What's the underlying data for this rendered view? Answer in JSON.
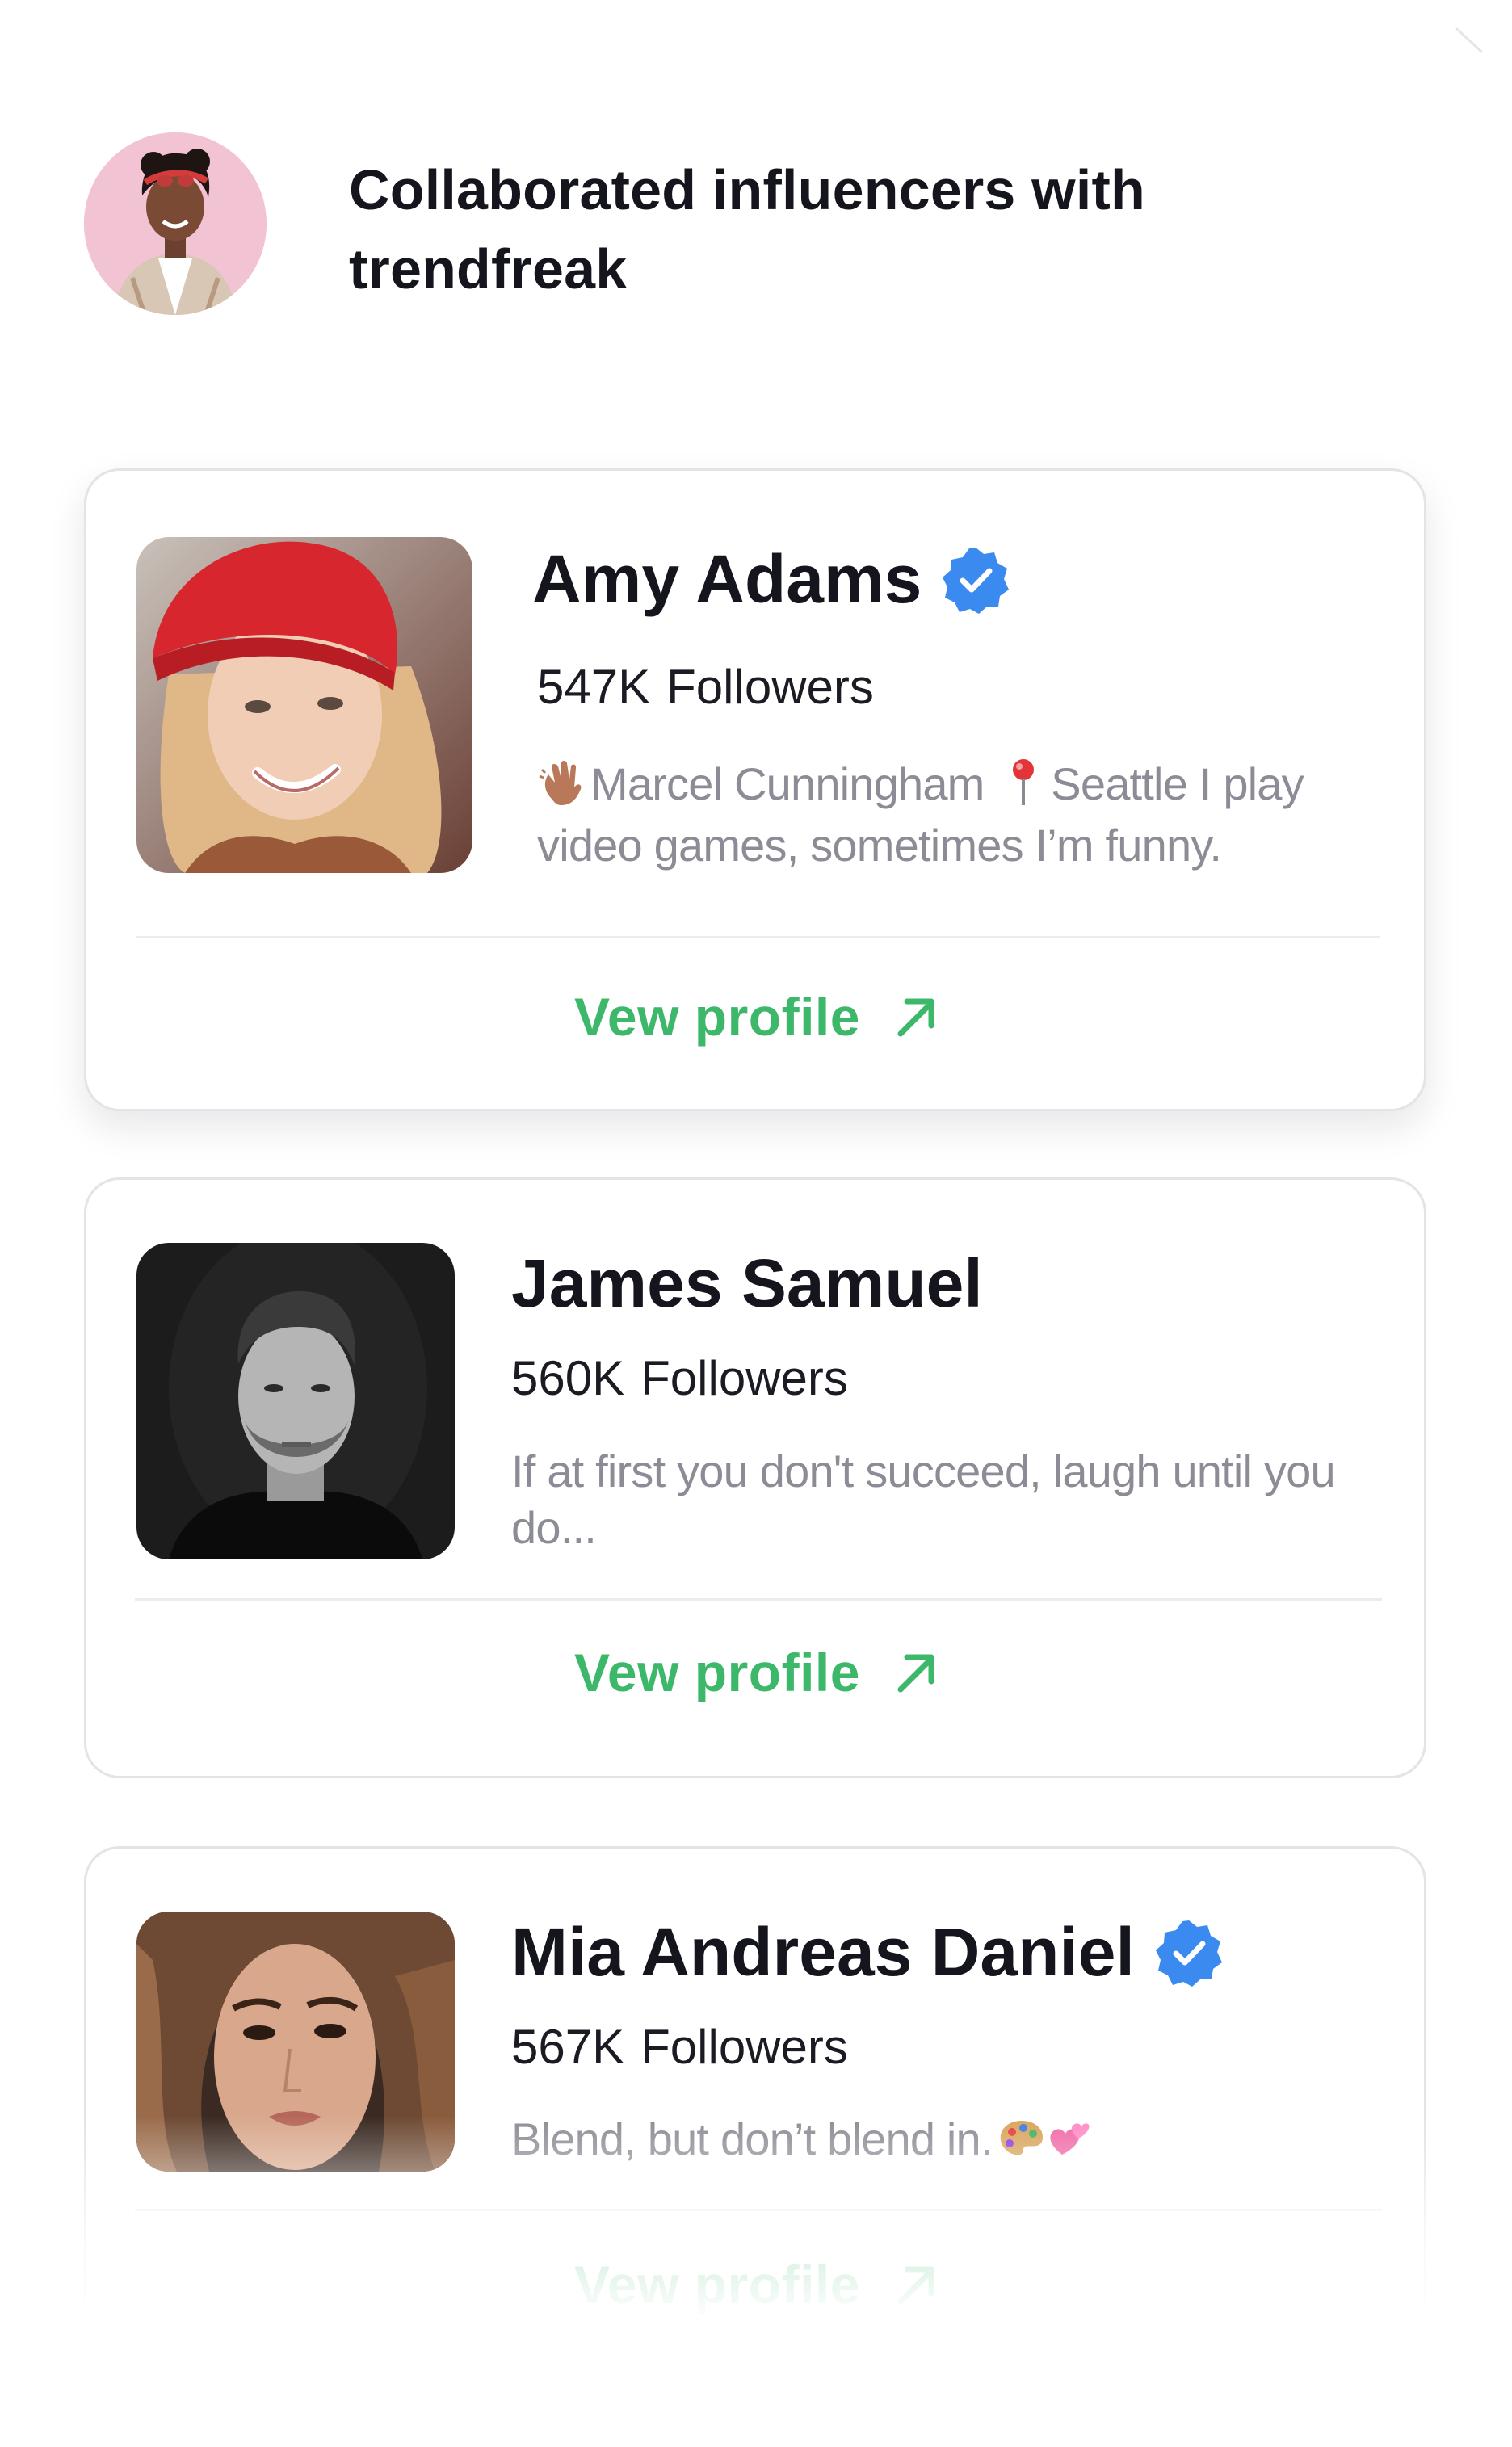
{
  "header": {
    "title_line1": "Collaborated influencers with",
    "title_line2": "trendfreak"
  },
  "colors": {
    "accent_green": "#3db86a",
    "verified_blue": "#3a8af0",
    "text_primary": "#15151e",
    "text_muted": "#8c8c96"
  },
  "influencers": [
    {
      "name": "Amy Adams",
      "verified": true,
      "followers_count": "547K",
      "followers_label": "Followers",
      "bio_parts": [
        "Marcel Cunningham",
        "Seattle I play video games, sometimes I’m funny."
      ],
      "bio_icons": [
        "waving-hand-icon",
        "pin-icon"
      ],
      "action_label": "Vew profile",
      "action_icon": "arrow-up-right-icon"
    },
    {
      "name": "James Samuel",
      "verified": false,
      "followers_count": "560K",
      "followers_label": "Followers",
      "bio": "If at first you don't succeed, laugh until you do...",
      "action_label": "Vew profile",
      "action_icon": "arrow-up-right-icon"
    },
    {
      "name": "Mia Andreas Daniel",
      "verified": true,
      "followers_count": "567K",
      "followers_label": "Followers",
      "bio": "Blend, but don’t blend in.",
      "bio_icons": [
        "palette-icon",
        "hearts-icon"
      ],
      "action_label": "Vew profile",
      "action_icon": "arrow-up-right-icon"
    }
  ]
}
